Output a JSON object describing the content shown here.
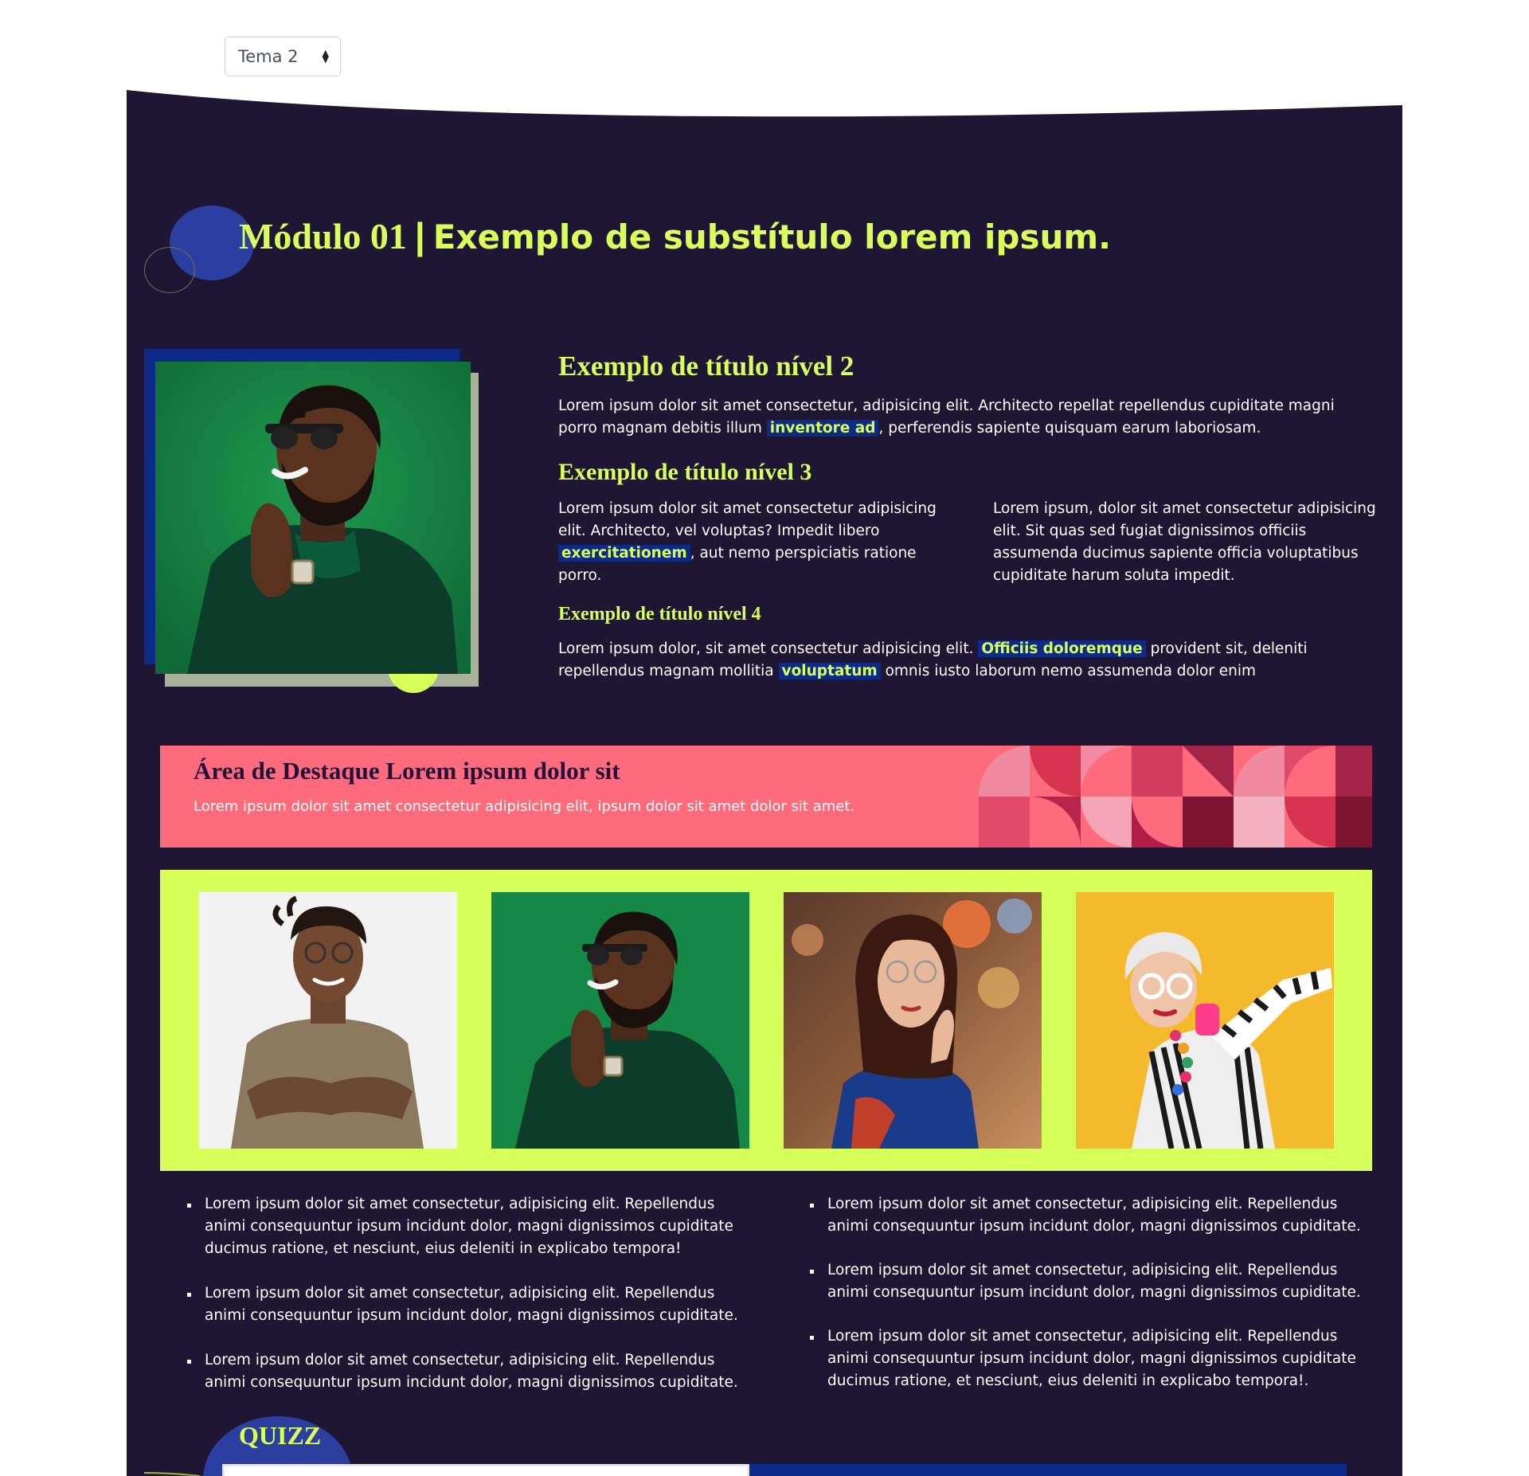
{
  "theme_select": {
    "value": "Tema 2",
    "icon": "sort-arrows-icon"
  },
  "module": {
    "name": "Módulo 01",
    "separator": "|",
    "subtitle": "Exemplo de substítulo lorem ipsum."
  },
  "content": {
    "h2": "Exemplo de título nível 2",
    "p1_before": "Lorem ipsum dolor sit amet consectetur, adipisicing elit. Architecto repellat repellendus cupiditate magni porro magnam debitis illum",
    "p1_highlight": "inventore ad",
    "p1_after": ", perferendis sapiente quisquam earum laboriosam.",
    "h3": "Exemplo de título nível 3",
    "col_left_before": "Lorem ipsum dolor sit amet consectetur adipisicing elit. Architecto, vel voluptas? Impedit libero",
    "col_left_highlight": "exercitationem",
    "col_left_after": ", aut nemo perspiciatis ratione porro.",
    "col_right": "Lorem ipsum, dolor sit amet consectetur adipisicing elit. Sit quas sed fugiat dignissimos officiis assumenda ducimus sapiente officia voluptatibus cupiditate harum soluta impedit.",
    "h4": "Exemplo de título nível 4",
    "p4_before": "Lorem ipsum dolor, sit amet consectetur adipisicing elit.",
    "p4_highlight1": "Officiis doloremque",
    "p4_middle": "provident sit, deleniti repellendus magnam mollitia",
    "p4_highlight2": "voluptatum",
    "p4_after": "omnis iusto laborum nemo assumenda dolor enim"
  },
  "destaque": {
    "title": "Área de Destaque Lorem ipsum dolor sit",
    "text": "Lorem ipsum dolor sit amet consectetur adipisicing elit, ipsum dolor sit amet dolor sit amet."
  },
  "gallery": [
    {
      "name": "man-crossed-arms-photo"
    },
    {
      "name": "man-green-background-photo"
    },
    {
      "name": "woman-glasses-city-photo"
    },
    {
      "name": "elderly-woman-dab-photo"
    }
  ],
  "bullets_left": [
    "Lorem ipsum dolor sit amet consectetur, adipisicing elit. Repellendus animi consequuntur ipsum incidunt dolor, magni dignissimos cupiditate ducimus ratione, et nesciunt, eius deleniti in explicabo tempora!",
    "Lorem ipsum dolor sit amet consectetur, adipisicing elit. Repellendus animi consequuntur ipsum incidunt dolor, magni dignissimos cupiditate.",
    "Lorem ipsum dolor sit amet consectetur, adipisicing elit. Repellendus animi consequuntur ipsum incidunt dolor, magni dignissimos cupiditate."
  ],
  "bullets_right": [
    "Lorem ipsum dolor sit amet consectetur, adipisicing elit. Repellendus animi consequuntur ipsum incidunt dolor, magni dignissimos cupiditate.",
    "Lorem ipsum dolor sit amet consectetur, adipisicing elit. Repellendus animi consequuntur ipsum incidunt dolor, magni dignissimos cupiditate.",
    "Lorem ipsum dolor sit amet consectetur, adipisicing elit. Repellendus animi consequuntur ipsum incidunt dolor, magni dignissimos cupiditate ducimus ratione, et nesciunt, eius deleniti in explicabo tempora!."
  ],
  "quizz": {
    "label": "QUIZZ"
  },
  "colors": {
    "panel_bg": "#1f1634",
    "accent_lime": "#d8ff5a",
    "accent_blue": "#2b3fa0",
    "highlight_bg": "#0d2a86",
    "destaque_pink": "#fe6b7d"
  }
}
